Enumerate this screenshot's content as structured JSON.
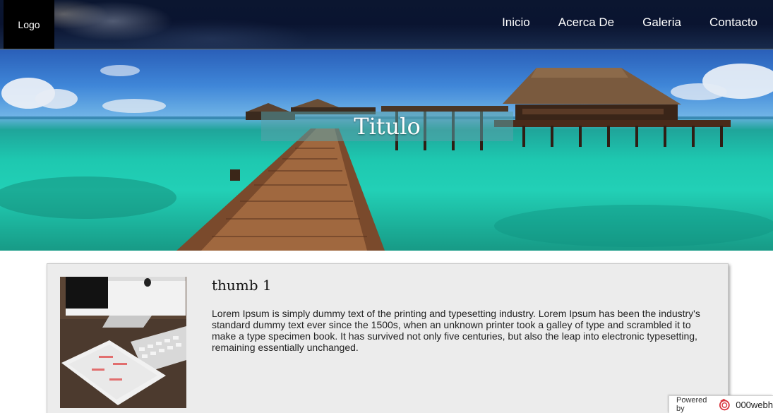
{
  "header": {
    "logo": "Logo",
    "nav": [
      {
        "label": "Inicio"
      },
      {
        "label": "Acerca De"
      },
      {
        "label": "Galeria"
      },
      {
        "label": "Contacto"
      }
    ]
  },
  "hero": {
    "title": "Titulo"
  },
  "card": {
    "title": "thumb 1",
    "text": "Lorem Ipsum is simply dummy text of the printing and typesetting industry. Lorem Ipsum has been the industry's standard dummy text ever since the 1500s, when an unknown printer took a galley of type and scrambled it to make a type specimen book. It has survived not only five centuries, but also the leap into electronic typesetting, remaining essentially unchanged."
  },
  "footer_badge": {
    "powered_label": "Powered by",
    "brand": "000webh"
  },
  "colors": {
    "header_bg": "#0b1630",
    "card_bg": "#ececec",
    "logo_bg": "#000000"
  }
}
